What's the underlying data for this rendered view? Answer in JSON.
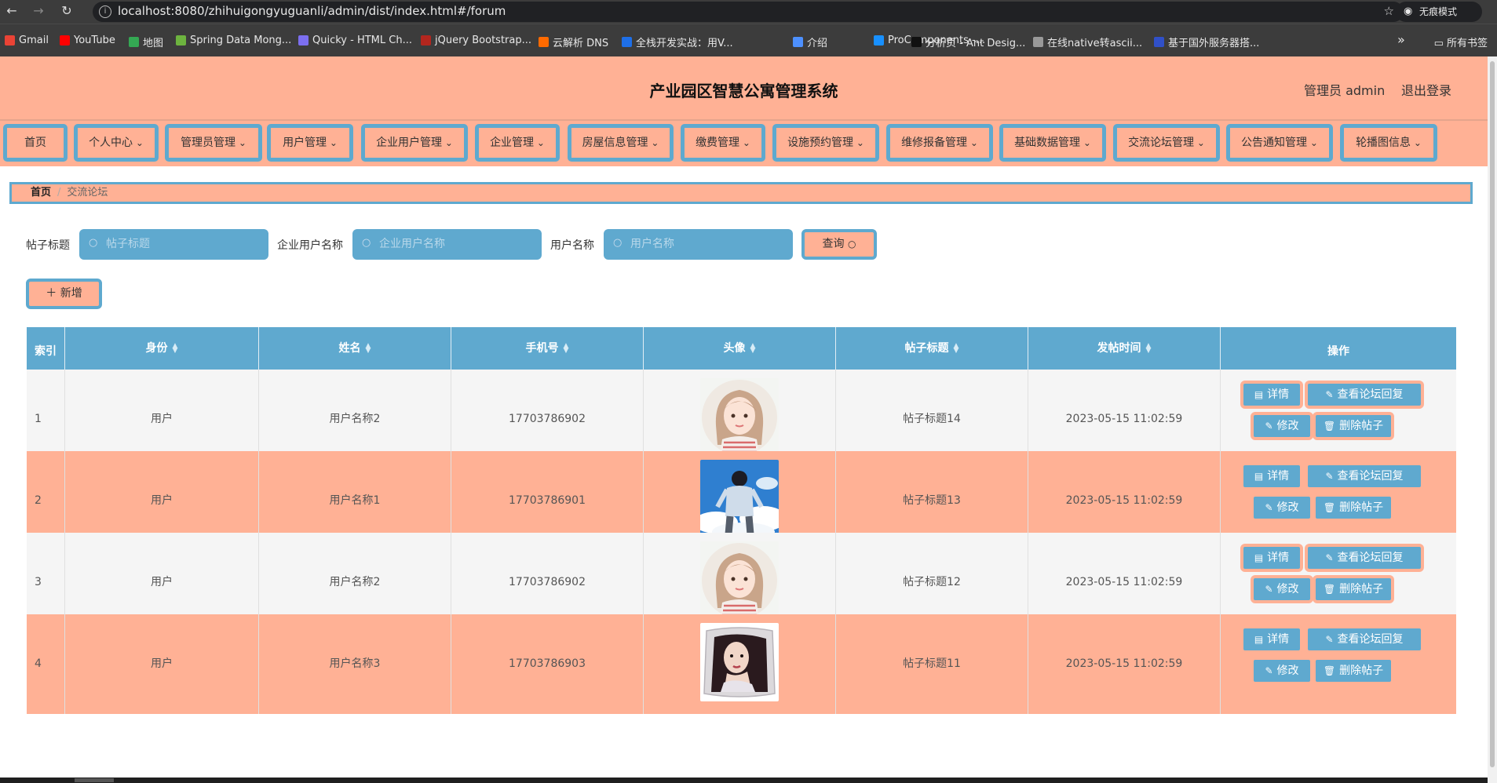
{
  "browser": {
    "url": "localhost:8080/zhihuigongyuguanli/admin/dist/index.html#/forum",
    "incognito_label": "无痕模式",
    "bookmarks": [
      {
        "label": "Gmail",
        "color": "#ea4335"
      },
      {
        "label": "YouTube",
        "color": "#ff0000"
      },
      {
        "label": "地图",
        "color": "#34a853"
      },
      {
        "label": "Spring Data Mong...",
        "color": "#6db33f"
      },
      {
        "label": "Quicky - HTML Ch...",
        "color": "#7c6ff0"
      },
      {
        "label": "jQuery Bootstrap...",
        "color": "#b3261e"
      },
      {
        "label": "云解析 DNS",
        "color": "#ff6a00"
      },
      {
        "label": "全栈开发实战：用V...",
        "color": "#1e6fe8"
      },
      {
        "label": "介绍",
        "color": "#4d90fe"
      },
      {
        "label": "ProComponents -...",
        "color": "#1890ff"
      },
      {
        "label": "分析页 - Ant Desig...",
        "color": "#111111"
      },
      {
        "label": "在线native转ascii...",
        "color": "#999999"
      },
      {
        "label": "基于国外服务器搭...",
        "color": "#3050c8"
      }
    ],
    "bookmarks_folder": "所有书签"
  },
  "header": {
    "title": "产业园区智慧公寓管理系统",
    "user_label": "管理员 admin",
    "logout_label": "退出登录"
  },
  "nav": [
    {
      "label": "首页",
      "dropdown": false
    },
    {
      "label": "个人中心",
      "dropdown": true
    },
    {
      "label": "管理员管理",
      "dropdown": true
    },
    {
      "label": "用户管理",
      "dropdown": true
    },
    {
      "label": "企业用户管理",
      "dropdown": true
    },
    {
      "label": "企业管理",
      "dropdown": true
    },
    {
      "label": "房屋信息管理",
      "dropdown": true
    },
    {
      "label": "缴费管理",
      "dropdown": true
    },
    {
      "label": "设施预约管理",
      "dropdown": true
    },
    {
      "label": "维修报备管理",
      "dropdown": true
    },
    {
      "label": "基础数据管理",
      "dropdown": true
    },
    {
      "label": "交流论坛管理",
      "dropdown": true
    },
    {
      "label": "公告通知管理",
      "dropdown": true
    },
    {
      "label": "轮播图信息",
      "dropdown": true
    }
  ],
  "breadcrumb": {
    "home": "首页",
    "separator": "/",
    "current": "交流论坛"
  },
  "filters": [
    {
      "label": "帖子标题",
      "placeholder": "帖子标题"
    },
    {
      "label": "企业用户名称",
      "placeholder": "企业用户名称"
    },
    {
      "label": "用户名称",
      "placeholder": "用户名称"
    }
  ],
  "query_label": "查询",
  "add_label": "新增",
  "table": {
    "columns": [
      "索引",
      "身份",
      "姓名",
      "手机号",
      "头像",
      "帖子标题",
      "发帖时间",
      "操作"
    ],
    "rows": [
      {
        "index": "1",
        "identity": "用户",
        "name": "用户名称2",
        "phone": "17703786902",
        "avatar": "girl-avatar",
        "title": "帖子标题14",
        "time": "2023-05-15 11:02:59"
      },
      {
        "index": "2",
        "identity": "用户",
        "name": "用户名称1",
        "phone": "17703786901",
        "avatar": "boy-sky-avatar",
        "title": "帖子标题13",
        "time": "2023-05-15 11:02:59"
      },
      {
        "index": "3",
        "identity": "用户",
        "name": "用户名称2",
        "phone": "17703786902",
        "avatar": "girl-avatar",
        "title": "帖子标题12",
        "time": "2023-05-15 11:02:59"
      },
      {
        "index": "4",
        "identity": "用户",
        "name": "用户名称3",
        "phone": "17703786903",
        "avatar": "woman-pillow-avatar",
        "title": "帖子标题11",
        "time": "2023-05-15 11:02:59"
      }
    ],
    "actions": {
      "detail": "详情",
      "replies": "查看论坛回复",
      "edit": "修改",
      "delete": "删除帖子"
    }
  },
  "colors": {
    "accent": "#ffb195",
    "primary": "#5fa9cf"
  }
}
